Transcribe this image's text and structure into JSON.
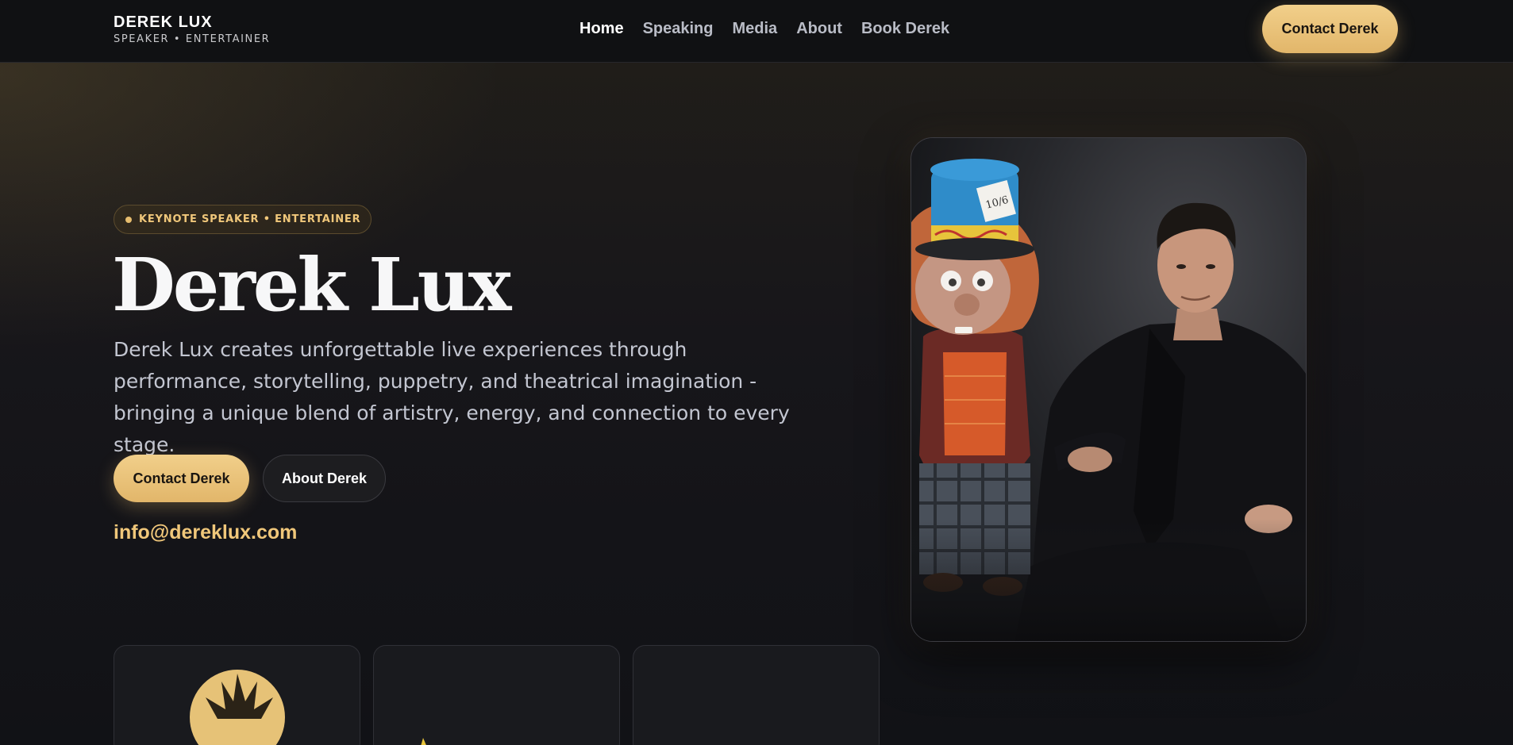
{
  "brand": {
    "name": "DEREK LUX",
    "tagline": "SPEAKER • ENTERTAINER"
  },
  "nav": {
    "links": [
      {
        "label": "Home",
        "active": true
      },
      {
        "label": "Speaking",
        "active": false
      },
      {
        "label": "Media",
        "active": false
      },
      {
        "label": "About",
        "active": false
      },
      {
        "label": "Book Derek",
        "active": false
      }
    ],
    "cta_label": "Contact Derek"
  },
  "hero": {
    "badge": "KEYNOTE SPEAKER • ENTERTAINER",
    "title": "Derek Lux",
    "description": "Derek Lux creates unforgettable live experiences through performance, storytelling, puppetry, and theatrical imagination - bringing a unique blend of artistry, energy, and connection to every stage.",
    "primary_button": "Contact Derek",
    "secondary_button": "About Derek",
    "email": "info@dereklux.com"
  },
  "photo": {
    "hat_card_text": "10/6"
  },
  "colors": {
    "accent": "#e7bd6e",
    "accent_light": "#f1cf8a",
    "background": "#141416",
    "nav_bg": "#101113",
    "text_muted": "#c3c6d1"
  },
  "feature_cards": [
    {
      "icon": "gold-seal-icon"
    },
    {
      "icon": "star-icon"
    },
    {
      "icon": "none"
    }
  ]
}
